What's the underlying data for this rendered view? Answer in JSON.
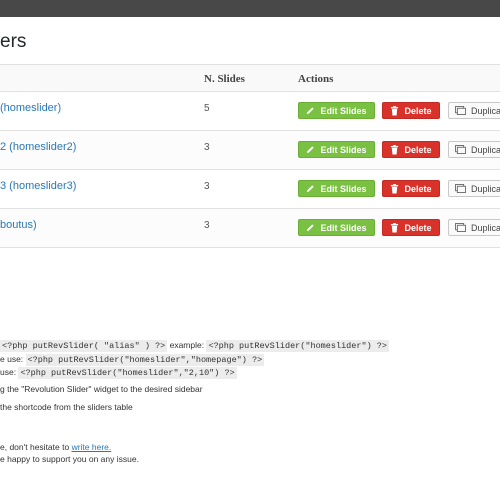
{
  "page": {
    "title": "ers"
  },
  "table": {
    "headers": {
      "slides": "N. Slides",
      "actions": "Actions"
    },
    "rows": [
      {
        "name": "(homeslider)",
        "slides": "5"
      },
      {
        "name": "2 (homeslider2)",
        "slides": "3"
      },
      {
        "name": "3 (homeslider3)",
        "slides": "3"
      },
      {
        "name": "boutus)",
        "slides": "3"
      }
    ],
    "buttons": {
      "edit": "Edit Slides",
      "delete": "Delete",
      "duplicate": "Duplica"
    }
  },
  "help": {
    "line1_code1": "<?php putRevSlider( \"alias\" ) ?>",
    "line1_text": " example: ",
    "line1_code2": "<?php putRevSlider(\"homeslider\") ?>",
    "line2_prefix": "e use: ",
    "line2_code": "<?php putRevSlider(\"homeslider\",\"homepage\") ?>",
    "line3_prefix": "use: ",
    "line3_code": "<?php putRevSlider(\"homeslider\",\"2,10\") ?>",
    "line4": "g the \"Revolution Slider\" widget to the desired sidebar",
    "line5": "the shortcode from the sliders table",
    "line6_prefix": "e, don't hesitate to ",
    "line6_link": "write here.",
    "line7": "e happy to support you on any issue."
  },
  "colors": {
    "edit": "#7ac143",
    "delete": "#d9322b",
    "link": "#2a78b6"
  }
}
